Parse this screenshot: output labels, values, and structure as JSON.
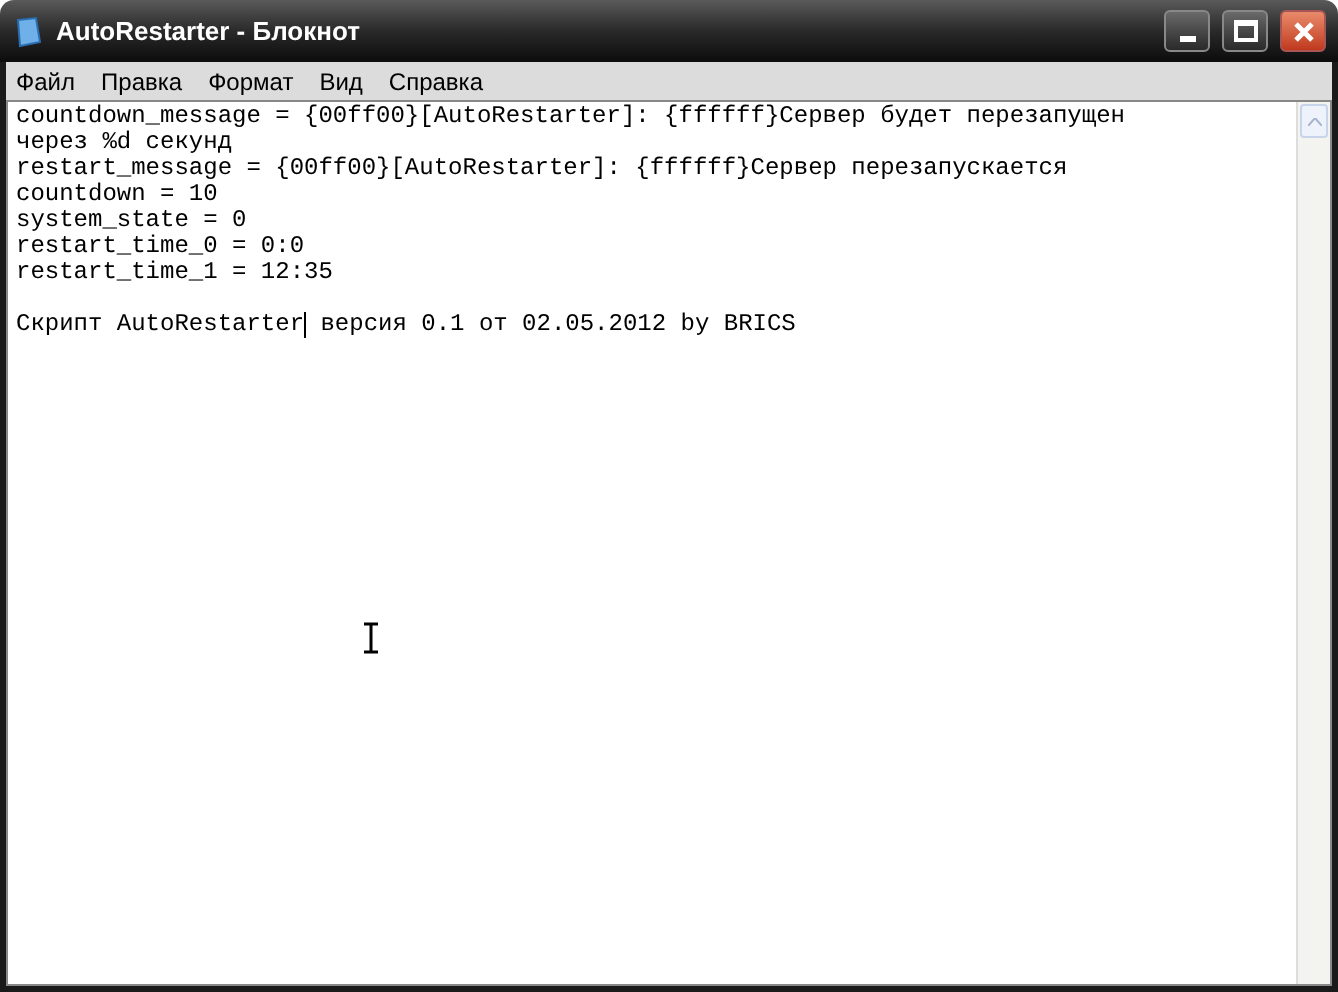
{
  "window": {
    "title": "AutoRestarter - Блокнот"
  },
  "menu": [
    "Файл",
    "Правка",
    "Формат",
    "Вид",
    "Справка"
  ],
  "editor": {
    "lines": [
      {
        "text": "countdown_message = {00ff00}[AutoRestarter]: {ffffff}Сервер будет перезапущен"
      },
      {
        "text": "через %d секунд"
      },
      {
        "text": "restart_message = {00ff00}[AutoRestarter]: {ffffff}Сервер перезапускается"
      },
      {
        "text": "countdown = 10"
      },
      {
        "text": "system_state = 0"
      },
      {
        "text": "restart_time_0 = 0:0"
      },
      {
        "text": "restart_time_1 = 12:35"
      },
      {
        "text": "Скрипт AutoRestarter",
        "caret_after": " версия 0.1 от 02.05.2012 by BRICS"
      }
    ]
  }
}
